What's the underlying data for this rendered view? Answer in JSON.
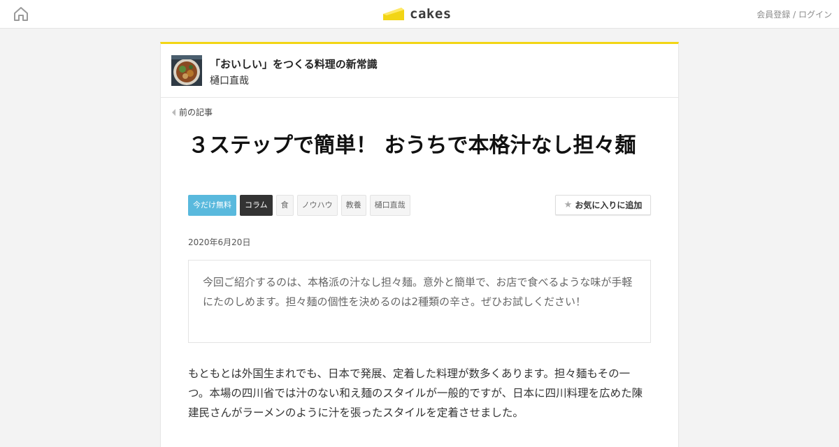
{
  "header": {
    "brand": "cakes",
    "auth_register": "会員登録",
    "auth_sep": " / ",
    "auth_login": "ログイン",
    "brand_color": "#f2d515"
  },
  "series": {
    "title": "「おいしい」をつくる料理の新常識",
    "author": "樋口直哉"
  },
  "nav": {
    "prev_label": "前の記事"
  },
  "article": {
    "title": "３ステップで簡単！ おうちで本格汁なし担々麺",
    "tags": [
      "今だけ無料",
      "コラム",
      "食",
      "ノウハウ",
      "教養",
      "樋口直哉"
    ],
    "favorite_label": "お気に入りに追加",
    "date": "2020年6月20日",
    "lead": "今回ご紹介するのは、本格派の汁なし担々麺。意外と簡単で、お店で食べるような味が手軽にたのしめます。担々麺の個性を決めるのは2種類の辛さ。ぜひお試しください！",
    "body": "もともとは外国生まれでも、日本で発展、定着した料理が数多くあります。担々麺もその一つ。本場の四川省では汁のない和え麺のスタイルが一般的ですが、日本に四川料理を広めた陳建民さんがラーメンのように汁を張ったスタイルを定着させました。"
  },
  "icons": {
    "home": "home-icon",
    "logo": "cake-slice-icon",
    "favorite": "star-icon",
    "prev": "triangle-left-icon"
  }
}
